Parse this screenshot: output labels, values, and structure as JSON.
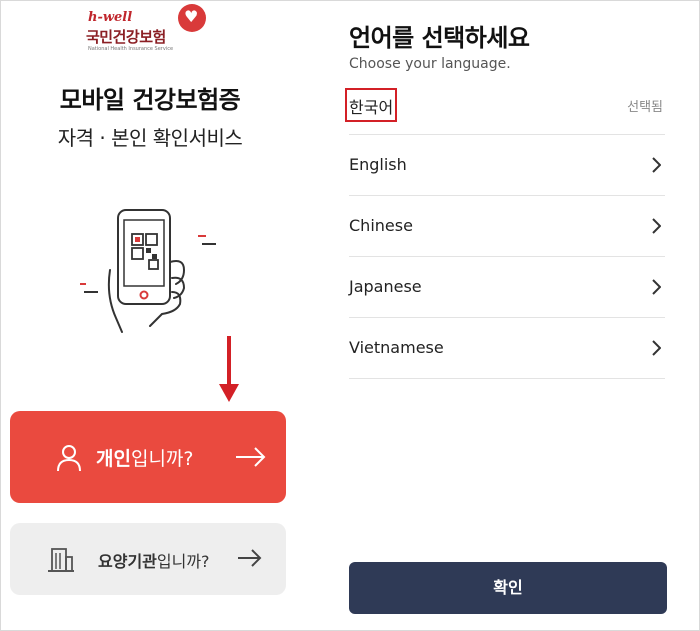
{
  "brand": {
    "logo_mark": "h-well",
    "org_name": "국민건강보험",
    "org_name_en": "National Health Insurance Service"
  },
  "left": {
    "title": "모바일 건강보험증",
    "subtitle": "자격 · 본인 확인서비스",
    "illustration_icon": "phone-qr-icon",
    "personal_button": {
      "bold": "개인",
      "rest": "입니까?",
      "icon": "person-icon"
    },
    "institution_button": {
      "bold": "요양기관",
      "rest": "입니까?",
      "icon": "building-icon"
    }
  },
  "right": {
    "title": "언어를 선택하세요",
    "subtitle": "Choose your language.",
    "languages": [
      {
        "label": "한국어",
        "status": "선택됨"
      },
      {
        "label": "English"
      },
      {
        "label": "Chinese"
      },
      {
        "label": "Japanese"
      },
      {
        "label": "Vietnamese"
      }
    ],
    "confirm_label": "확인"
  },
  "colors": {
    "primary_red": "#ea4a3f",
    "confirm_navy": "#2f3a56",
    "highlight_red": "#d32026",
    "institution_gray": "#eeeeee"
  }
}
